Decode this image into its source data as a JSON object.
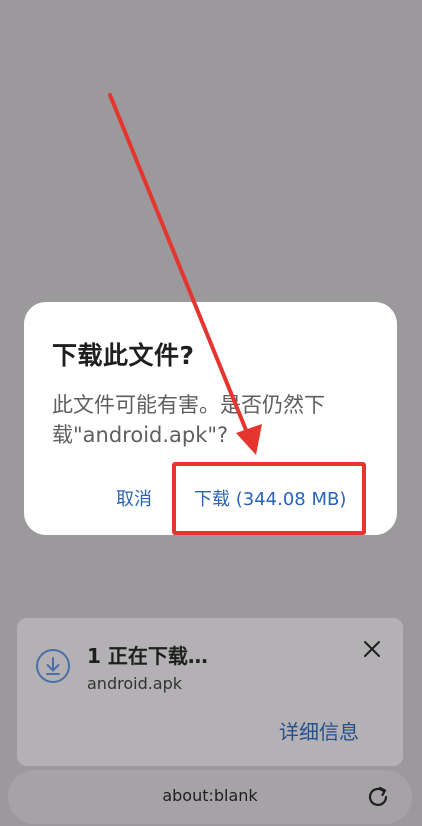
{
  "dialog": {
    "title": "下载此文件?",
    "message": "此文件可能有害。是否仍然下载\"android.apk\"?",
    "cancel_label": "取消",
    "download_label": "下载 (344.08 MB)"
  },
  "notification": {
    "title": "1 正在下载…",
    "filename": "android.apk",
    "details_label": "详细信息",
    "icon": "download-icon"
  },
  "address_bar": {
    "url": "about:blank",
    "icon": "reload-icon"
  },
  "colors": {
    "accent": "#2a64b8",
    "annotation": "#e5352f",
    "scrim": "#9b999c"
  }
}
